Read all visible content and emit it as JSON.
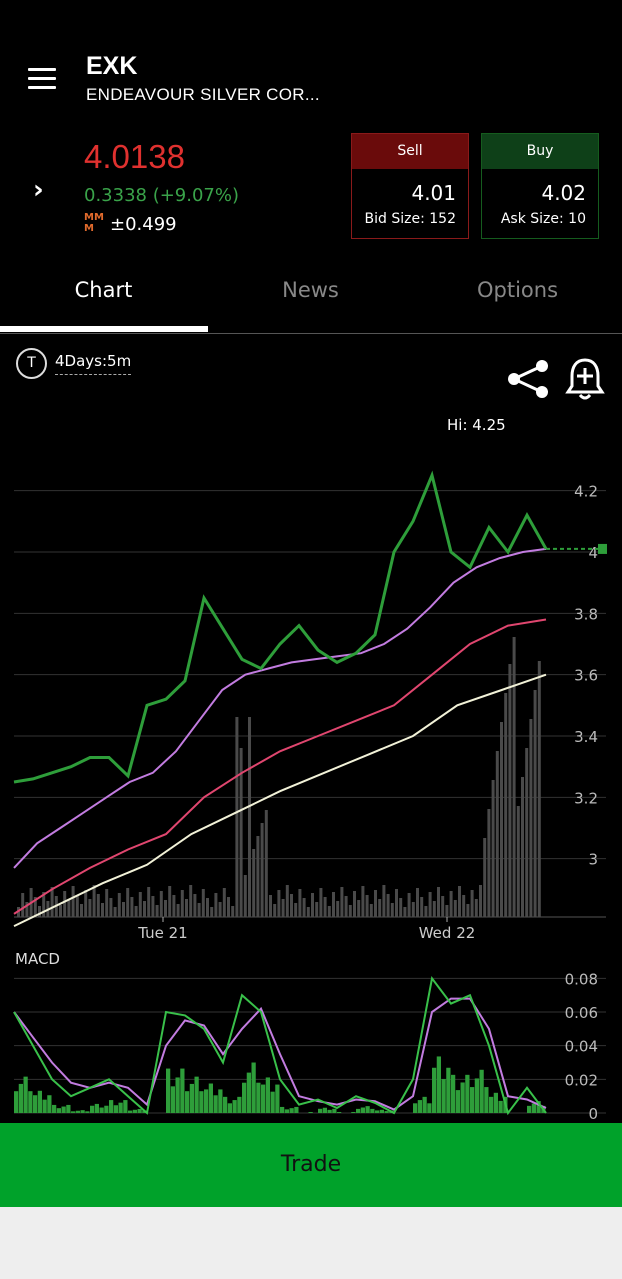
{
  "header": {
    "ticker": "EXK",
    "company": "ENDEAVOUR SILVER COR..."
  },
  "quote": {
    "last": "4.0138",
    "change": "0.3338 (+9.07%)",
    "mm_icon": "MM\nM",
    "mm_value": "±0.499"
  },
  "sell": {
    "label": "Sell",
    "price": "4.01",
    "size": "Bid Size: 152"
  },
  "buy": {
    "label": "Buy",
    "price": "4.02",
    "size": "Ask Size: 10"
  },
  "tabs": [
    "Chart",
    "News",
    "Options"
  ],
  "chart_controls": {
    "period_icon": "T",
    "period": "4Days:5m",
    "share_icon": "share-icon",
    "bell_icon": "bell-plus-icon"
  },
  "chart_data": {
    "type": "line",
    "hi_label": "Hi: 4.25",
    "ylim": [
      2.8,
      4.3
    ],
    "yticks": [
      "4.2",
      "4",
      "3.8",
      "3.6",
      "3.4",
      "3.2",
      "3"
    ],
    "xticks": [
      "Tue 21",
      "Wed 22"
    ],
    "current_price": 4.01,
    "series": [
      {
        "values": [
          3.25,
          3.26,
          3.28,
          3.3,
          3.33,
          3.33,
          3.27,
          3.5,
          3.52,
          3.58,
          3.85,
          3.75,
          3.65,
          3.62,
          3.7,
          3.76,
          3.68,
          3.64,
          3.67,
          3.73,
          4.0,
          4.1,
          4.25,
          4.0,
          3.95,
          4.08,
          4.0,
          4.12,
          4.01
        ]
      },
      {
        "values": [
          2.97,
          3.05,
          3.1,
          3.15,
          3.2,
          3.25,
          3.28,
          3.35,
          3.45,
          3.55,
          3.6,
          3.62,
          3.64,
          3.65,
          3.66,
          3.67,
          3.7,
          3.75,
          3.82,
          3.9,
          3.95,
          3.98,
          4.0,
          4.01
        ]
      },
      {
        "values": [
          2.82,
          2.9,
          2.97,
          3.03,
          3.08,
          3.2,
          3.28,
          3.35,
          3.4,
          3.45,
          3.5,
          3.6,
          3.7,
          3.76,
          3.78
        ]
      },
      {
        "values": [
          2.78,
          2.85,
          2.92,
          2.98,
          3.08,
          3.15,
          3.22,
          3.28,
          3.34,
          3.4,
          3.5,
          3.55,
          3.6
        ]
      }
    ],
    "macd": {
      "label": "MACD",
      "yticks": [
        "0.08",
        "0.06",
        "0.04",
        "0.02",
        "0"
      ],
      "ylim": [
        0,
        0.082
      ],
      "macd_line": [
        0.06,
        0.04,
        0.02,
        0.01,
        0.015,
        0.02,
        0.01,
        0.0,
        0.06,
        0.058,
        0.05,
        0.03,
        0.07,
        0.06,
        0.02,
        0.005,
        0.008,
        0.003,
        0.01,
        0.006,
        0.0,
        0.02,
        0.08,
        0.065,
        0.07,
        0.04,
        0.0,
        0.015,
        0.0
      ],
      "signal_line": [
        0.06,
        0.045,
        0.03,
        0.018,
        0.015,
        0.018,
        0.015,
        0.005,
        0.04,
        0.055,
        0.052,
        0.035,
        0.05,
        0.062,
        0.035,
        0.01,
        0.007,
        0.005,
        0.008,
        0.007,
        0.002,
        0.01,
        0.06,
        0.068,
        0.068,
        0.05,
        0.01,
        0.008,
        0.003
      ]
    }
  },
  "trade_label": "Trade",
  "colors": {
    "up": "#2e9e3a",
    "down": "#e03b3b",
    "ma_fast": "#c27ce0",
    "ma_mid": "#e0466f",
    "ma_slow": "#f2f2d8",
    "trade": "#00a22a"
  }
}
